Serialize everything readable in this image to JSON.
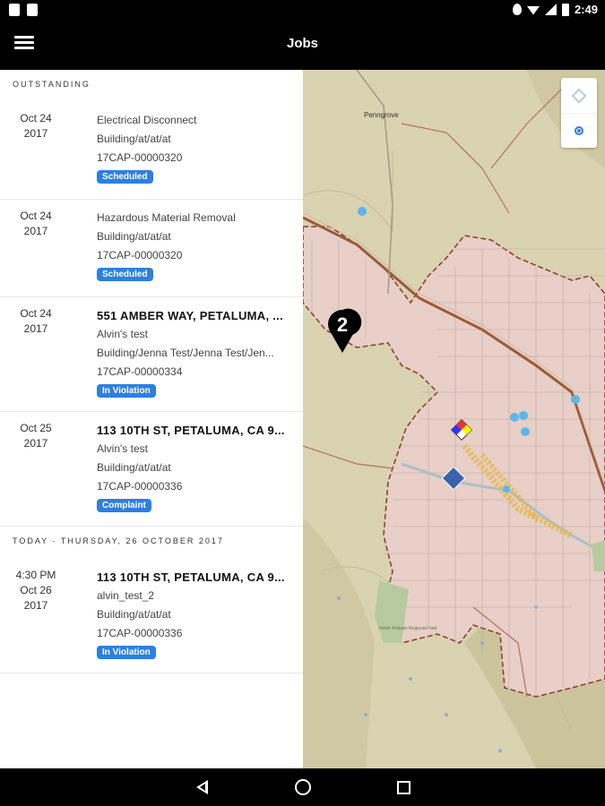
{
  "status_bar": {
    "time": "2:49"
  },
  "app_bar": {
    "title": "Jobs",
    "menu_icon": "hamburger-menu-icon"
  },
  "sections": [
    {
      "header": "OUTSTANDING",
      "jobs": [
        {
          "date_lines": [
            "Oct 24",
            "2017"
          ],
          "title": "Electrical Disconnect",
          "title_is_address": false,
          "lines": [
            "Building/at/at/at",
            "17CAP-00000320"
          ],
          "status": "Scheduled"
        },
        {
          "date_lines": [
            "Oct 24",
            "2017"
          ],
          "title": "Hazardous Material Removal",
          "title_is_address": false,
          "lines": [
            "Building/at/at/at",
            "17CAP-00000320"
          ],
          "status": "Scheduled"
        },
        {
          "date_lines": [
            "Oct 24",
            "2017"
          ],
          "title": "551 AMBER WAY, PETALUMA, ...",
          "title_is_address": true,
          "lines": [
            "Alvin's test",
            "Building/Jenna Test/Jenna Test/Jen...",
            "17CAP-00000334"
          ],
          "status": "In Violation"
        },
        {
          "date_lines": [
            "Oct 25",
            "2017"
          ],
          "title": "113 10TH ST, PETALUMA, CA 9...",
          "title_is_address": true,
          "lines": [
            "Alvin's test",
            "Building/at/at/at",
            "17CAP-00000336"
          ],
          "status": "Complaint"
        }
      ]
    },
    {
      "header": "TODAY · THURSDAY, 26 OCTOBER 2017",
      "jobs": [
        {
          "date_lines": [
            "4:30 PM",
            "Oct 26",
            "2017"
          ],
          "title": "113 10TH ST, PETALUMA, CA 9...",
          "title_is_address": true,
          "lines": [
            "alvin_test_2",
            "Building/at/at/at",
            "17CAP-00000336"
          ],
          "status": "In Violation"
        }
      ]
    }
  ],
  "map": {
    "place_labels": [
      "Penngrove",
      "Helen Putnam Regional Park"
    ],
    "cluster_marker_count": "2",
    "layers_icon": "layers-icon",
    "locate_icon": "my-location-icon"
  },
  "nav_bar": {
    "back_icon": "back-icon",
    "home_icon": "home-icon",
    "recents_icon": "recents-icon"
  },
  "colors": {
    "badge": "#2d7fe0",
    "map_base": "#d9d3b1",
    "city_area": "#e8cfc7",
    "boundary": "#8a3a28"
  }
}
